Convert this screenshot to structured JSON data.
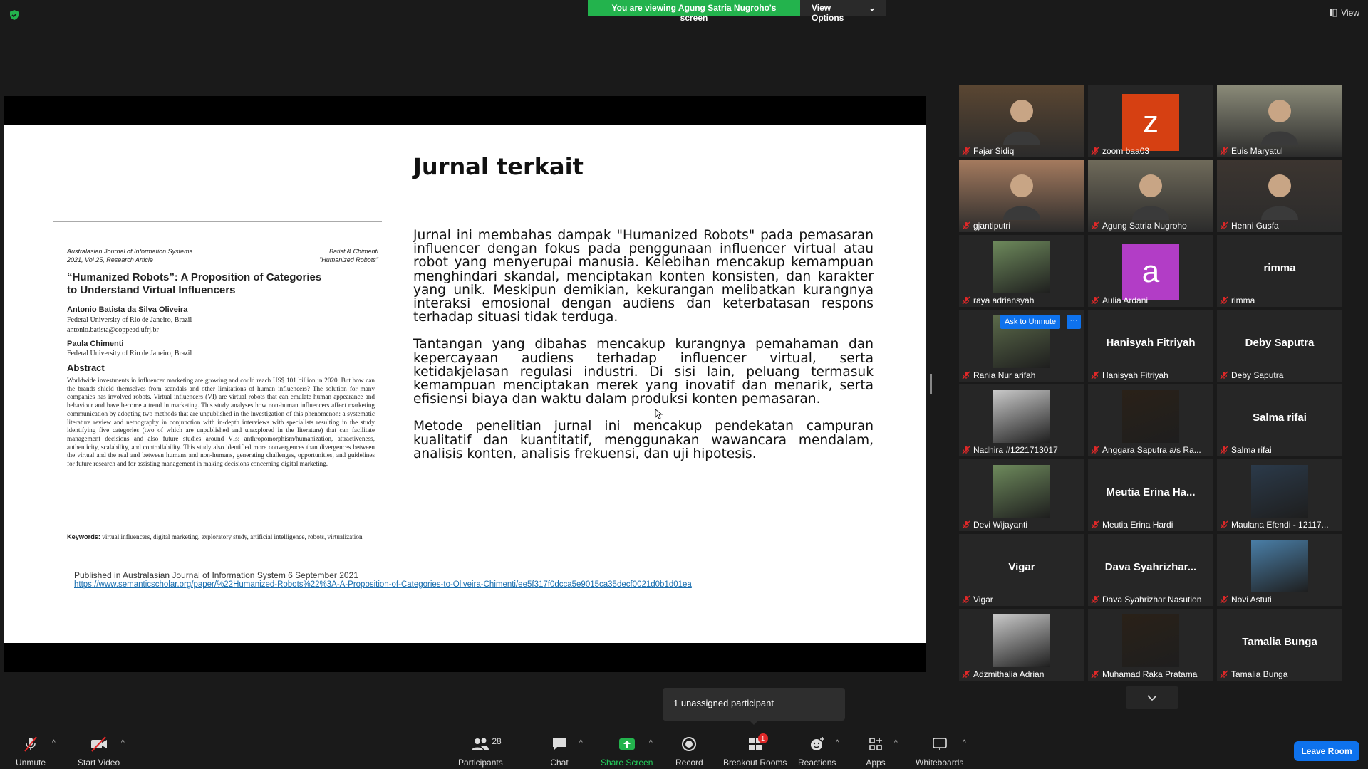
{
  "top": {
    "viewing_banner": "You are viewing Agung Satria Nugroho's screen",
    "view_options": "View Options",
    "view": "View"
  },
  "slide": {
    "title": "Jurnal terkait",
    "paragraphs": [
      "Jurnal ini membahas dampak \"Humanized Robots\" pada pemasaran influencer dengan fokus pada penggunaan influencer virtual atau robot yang menyerupai manusia. Kelebihan mencakup kemampuan menghindari skandal, menciptakan konten konsisten, dan karakter yang unik. Meskipun demikian, kekurangan melibatkan kurangnya interaksi emosional dengan audiens dan keterbatasan respons terhadap situasi tidak terduga.",
      "Tantangan yang dibahas mencakup kurangnya pemahaman dan kepercayaan audiens terhadap influencer virtual, serta ketidakjelasan regulasi industri. Di sisi lain, peluang termasuk kemampuan menciptakan merek yang inovatif dan menarik, serta efisiensi biaya dan waktu dalam produksi konten pemasaran.",
      "Metode penelitian jurnal ini mencakup pendekatan campuran kualitatif dan kuantitatif, menggunakan wawancara mendalam, analisis konten, analisis frekuensi, dan uji hipotesis."
    ],
    "paper": {
      "journal_line1": "Australasian Journal of Information Systems",
      "journal_line2": "2021, Vol 25, Research Article",
      "right_line1": "Batist & Chimenti",
      "right_line2": "\"Humanized Robots\"",
      "title": "“Humanized Robots”: A Proposition of Categories to Understand Virtual Influencers",
      "author1": "Antonio Batista da Silva Oliveira",
      "affil1_line1": "Federal University of Rio de Janeiro, Brazil",
      "affil1_line2": "antonio.batista@coppead.ufrj.br",
      "author2": "Paula Chimenti",
      "affil2": "Federal University of Rio de Janeiro, Brazil",
      "abstract_heading": "Abstract",
      "abstract": "Worldwide investments in influencer marketing are growing and could reach US$ 101 billion in 2020. But how can the brands shield themselves from scandals and other limitations of human influencers? The solution for many companies has involved robots. Virtual influencers (VI) are virtual robots that can emulate human appearance and behaviour and have become a trend in marketing. This study analyses how non-human influencers affect marketing communication by adopting two methods that are unpublished in the investigation of this phenomenon: a systematic literature review and netnography in conjunction with in-depth interviews with specialists resulting in the study identifying five categories (two of which are unpublished and unexplored in the literature) that can facilitate management decisions and also future studies around VIs: anthropomorphism/humanization, attractiveness, authenticity, scalability, and controllability. This study also identified more convergences than divergences between the virtual and the real and between humans and non-humans, generating challenges, opportunities, and guidelines for future research and for assisting management in making decisions concerning digital marketing.",
      "keywords_label": "Keywords:",
      "keywords": "virtual influencers, digital marketing, exploratory study, artificial intelligence, robots, virtualization"
    },
    "published": "Published in Australasian Journal of Information System 6 September 2021",
    "link": "https://www.semanticscholar.org/paper/%22Humanized-Robots%22%3A-A-Proposition-of-Categories-to-Oliveira-Chimenti/ee5f317f0dcca5e9015ca35decf0021d0b1d01ea"
  },
  "participants": [
    {
      "name": "Fajar Sidiq",
      "kind": "video"
    },
    {
      "name": "zoom baa03",
      "kind": "letter",
      "letter": "z",
      "color": "#d64012"
    },
    {
      "name": "Euis Maryatul",
      "kind": "video"
    },
    {
      "name": "gjantiputri",
      "kind": "video"
    },
    {
      "name": "Agung Satria Nugroho",
      "kind": "video"
    },
    {
      "name": "Henni Gusfa",
      "kind": "video"
    },
    {
      "name": "raya adriansyah",
      "kind": "photo"
    },
    {
      "name": "Aulia Ardani",
      "kind": "letter",
      "letter": "a",
      "color": "#b23dc6"
    },
    {
      "name": "rimma",
      "kind": "text",
      "display": "rimma"
    },
    {
      "name": "Rania Nur arifah",
      "kind": "photo"
    },
    {
      "name": "Hanisyah Fitriyah",
      "kind": "text",
      "display": "Hanisyah Fitriyah"
    },
    {
      "name": "Deby Saputra",
      "kind": "text",
      "display": "Deby Saputra"
    },
    {
      "name": "Nadhira #1221713017",
      "kind": "photo"
    },
    {
      "name": "Anggara Saputra a/s Ra...",
      "kind": "photo"
    },
    {
      "name": "Salma rifai",
      "kind": "text",
      "display": "Salma rifai"
    },
    {
      "name": "Devi Wijayanti",
      "kind": "photo"
    },
    {
      "name": "Meutia Erina Hardi",
      "kind": "text",
      "display": "Meutia  Erina  Ha..."
    },
    {
      "name": "Maulana Efendi - 12117...",
      "kind": "photo"
    },
    {
      "name": "Vigar",
      "kind": "text",
      "display": "Vigar"
    },
    {
      "name": "Dava Syahrizhar Nasution",
      "kind": "text",
      "display": "Dava  Syahrizhar..."
    },
    {
      "name": "Novi Astuti",
      "kind": "photo"
    },
    {
      "name": "Adzmithalia Adrian",
      "kind": "photo"
    },
    {
      "name": "Muhamad Raka Pratama",
      "kind": "photo"
    },
    {
      "name": "Tamalia Bunga",
      "kind": "text",
      "display": "Tamalia Bunga"
    }
  ],
  "ask_unmute": "Ask to Unmute",
  "ask_more": "···",
  "toast": "1 unassigned participant",
  "toolbar": {
    "unmute": "Unmute",
    "start_video": "Start Video",
    "participants": "Participants",
    "participants_count": "28",
    "chat": "Chat",
    "share_screen": "Share Screen",
    "record": "Record",
    "breakout_rooms": "Breakout Rooms",
    "breakout_badge": "1",
    "reactions": "Reactions",
    "apps": "Apps",
    "whiteboards": "Whiteboards",
    "leave_room": "Leave Room"
  }
}
